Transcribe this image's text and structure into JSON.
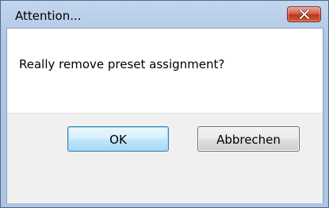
{
  "dialog": {
    "title": "Attention...",
    "message": "Really remove preset assignment?",
    "buttons": {
      "ok_label": "OK",
      "cancel_label": "Abbrechen"
    },
    "icons": {
      "close": "close-icon"
    },
    "colors": {
      "titlebar": "#b8cde8",
      "close_button": "#c0341c",
      "default_button_border": "#3c7fb1",
      "button_area": "#f0f0f0"
    }
  }
}
